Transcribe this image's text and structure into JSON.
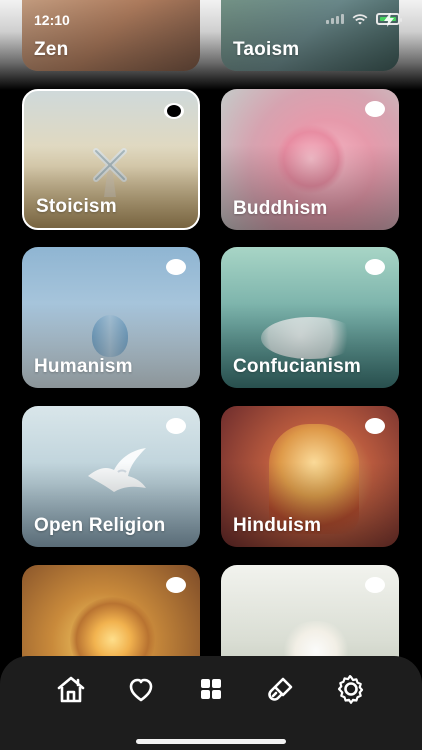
{
  "status_bar": {
    "time": "12:10"
  },
  "categories": [
    {
      "label": "Zen",
      "selected": false
    },
    {
      "label": "Taoism",
      "selected": false
    },
    {
      "label": "Stoicism",
      "selected": true
    },
    {
      "label": "Buddhism",
      "selected": false
    },
    {
      "label": "Humanism",
      "selected": false
    },
    {
      "label": "Confucianism",
      "selected": false
    },
    {
      "label": "Open Religion",
      "selected": false
    },
    {
      "label": "Hinduism",
      "selected": false
    }
  ],
  "bottom_nav": {
    "items": [
      {
        "icon": "home-icon"
      },
      {
        "icon": "heart-icon"
      },
      {
        "icon": "grid-icon"
      },
      {
        "icon": "brush-icon"
      },
      {
        "icon": "gear-icon"
      }
    ]
  },
  "colors": {
    "background": "#000000",
    "nav_background": "#1d1d1d",
    "label": "#ffffff",
    "battery_fill": "#47d15f"
  }
}
